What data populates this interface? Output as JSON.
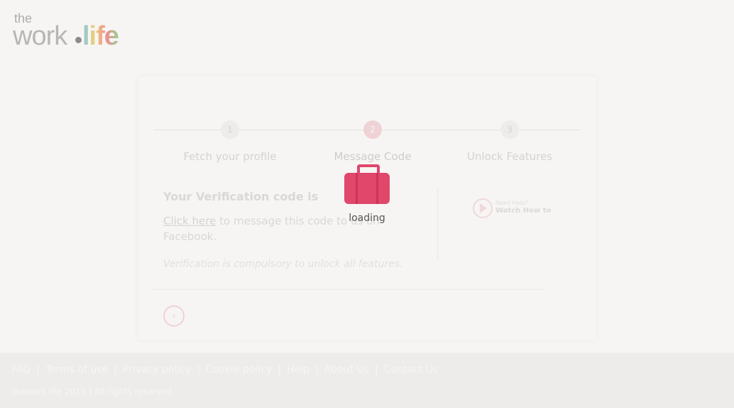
{
  "header": {
    "logo_the": "the",
    "logo_work": "work",
    "logo_life": "life"
  },
  "steps": [
    {
      "number": "1",
      "label": "Fetch your profile",
      "active": false
    },
    {
      "number": "2",
      "label": "Message Code",
      "active": true
    },
    {
      "number": "3",
      "label": "Unlock Features",
      "active": false
    }
  ],
  "verification": {
    "title": "Your Verification code is",
    "link_text": "Click here",
    "description_rest": " to message this code to us on Facebook.",
    "note": "Verification is compulsory to unlock all features."
  },
  "help": {
    "small": "Need Help?",
    "big": "Watch How to"
  },
  "back_icon": "chevron-left-icon",
  "loader": {
    "icon": "briefcase-icon",
    "text": "loading",
    "color": "#e0476b"
  },
  "footer": {
    "links": [
      "FAQ",
      "Terms of use",
      "Privacy policy",
      "Cookie policy",
      "Help",
      "About Us",
      "Contact Us"
    ],
    "copyright": "thework.life 2018 | All rights reserved"
  }
}
